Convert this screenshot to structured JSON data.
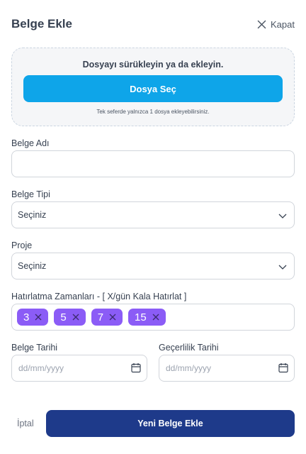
{
  "header": {
    "title": "Belge Ekle",
    "close_label": "Kapat"
  },
  "dropzone": {
    "text": "Dosyayı sürükleyin ya da ekleyin.",
    "button_label": "Dosya Seç",
    "hint": "Tek seferde yalnızca 1 dosya ekleyebilirsiniz."
  },
  "form": {
    "name": {
      "label": "Belge Adı",
      "value": "",
      "placeholder": ""
    },
    "type": {
      "label": "Belge Tipi",
      "selected": "Seçiniz"
    },
    "project": {
      "label": "Proje",
      "selected": "Seçiniz"
    },
    "reminders": {
      "label": "Hatırlatma Zamanları - [ X/gün Kala Hatırlat ]",
      "chips": [
        "3",
        "5",
        "7",
        "15"
      ]
    },
    "doc_date": {
      "label": "Belge Tarihi",
      "placeholder": "dd/mm/yyyy"
    },
    "valid_date": {
      "label": "Geçerlilik Tarihi",
      "placeholder": "dd/mm/yyyy"
    }
  },
  "footer": {
    "cancel_label": "İptal",
    "submit_label": "Yeni Belge Ekle"
  },
  "colors": {
    "primary_button": "#1e3a8a",
    "upload_button": "#0ea5e9",
    "chip": "#8b5cf6"
  }
}
